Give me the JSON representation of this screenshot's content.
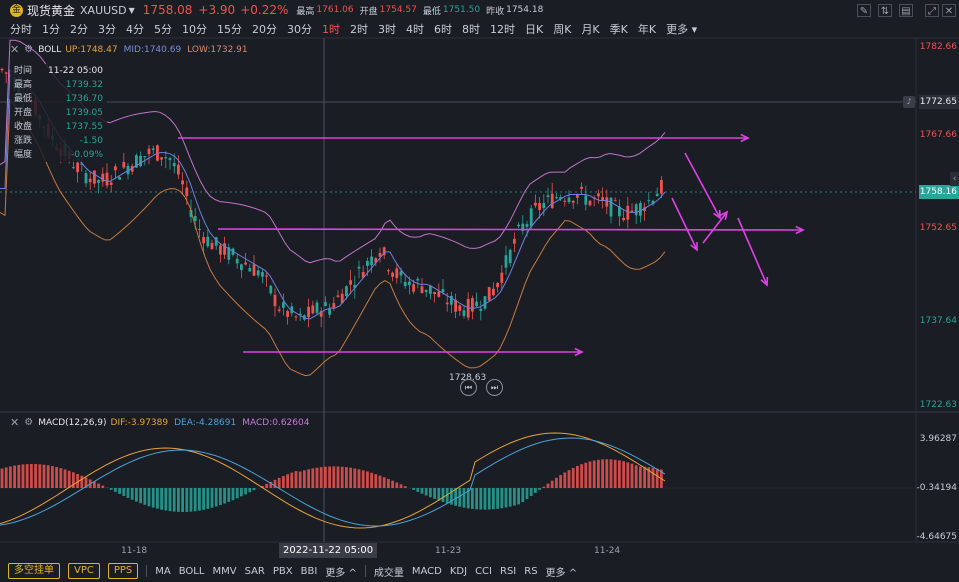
{
  "header": {
    "symbol_icon": "gold-coin-icon",
    "symbol_name": "现货黄金",
    "symbol_code": "XAUUSD",
    "price": "1758.08",
    "change": "+3.90",
    "change_pct": "+0.22%",
    "quotes": [
      {
        "label": "最高",
        "value": "1761.06",
        "tone": "up"
      },
      {
        "label": "开盘",
        "value": "1754.57",
        "tone": "up"
      },
      {
        "label": "最低",
        "value": "1751.50",
        "tone": "dn"
      },
      {
        "label": "昨收",
        "value": "1754.18",
        "tone": "nt"
      }
    ],
    "tool_icons": [
      "draw-icon",
      "indicator-icon",
      "layout-icon",
      "fullscreen-icon"
    ]
  },
  "periods": [
    "分时",
    "1分",
    "2分",
    "3分",
    "4分",
    "5分",
    "10分",
    "15分",
    "20分",
    "30分",
    "1时",
    "2时",
    "3时",
    "4时",
    "6时",
    "8时",
    "12时",
    "日K",
    "周K",
    "月K",
    "季K",
    "年K",
    "更多"
  ],
  "active_period": "1时",
  "boll": {
    "name": "BOLL",
    "up": "UP:1748.47",
    "mid": "MID:1740.69",
    "low": "LOW:1732.91"
  },
  "ohlc_tooltip": [
    {
      "label": "时间",
      "value": "11-22 05:00"
    },
    {
      "label": "最高",
      "value": "1739.32"
    },
    {
      "label": "最低",
      "value": "1736.70"
    },
    {
      "label": "开盘",
      "value": "1739.05"
    },
    {
      "label": "收盘",
      "value": "1737.55"
    },
    {
      "label": "涨跌",
      "value": "-1.50"
    },
    {
      "label": "幅度",
      "value": "-0.09%"
    }
  ],
  "price_axis": [
    "1782.66",
    "1767.66",
    "1752.65",
    "1737.64",
    "1722.63"
  ],
  "crosshair_price": "1772.65",
  "current_price_tag": "1758.16",
  "min_label": "1728.63",
  "macd": {
    "name": "MACD(12,26,9)",
    "dif": "DIF:-3.97389",
    "dea": "DEA:-4.28691",
    "macd": "MACD:0.62604"
  },
  "macd_axis": [
    "3.96287",
    "-0.34194",
    "-4.64675"
  ],
  "time_axis": [
    "11-18",
    "11-23",
    "11-24"
  ],
  "crosshair_time": "2022-11-22 05:00",
  "bottom_buttons": [
    "多空挂单",
    "VPC",
    "PPS"
  ],
  "main_indicators": [
    "MA",
    "BOLL",
    "MMV",
    "SAR",
    "PBX",
    "BBI",
    "更多 ^"
  ],
  "sub_indicators": [
    "成交量",
    "MACD",
    "KDJ",
    "CCI",
    "RSI",
    "RS",
    "更多 ^"
  ],
  "colors": {
    "up": "#ef5350",
    "down": "#26a69a",
    "boll_band": "#c074c8",
    "boll_mid": "#6f7fe0",
    "boll_low": "#c67a3e",
    "annotation": "#e040e8",
    "dif": "#e8a23a",
    "dea": "#4aa3d8"
  }
}
